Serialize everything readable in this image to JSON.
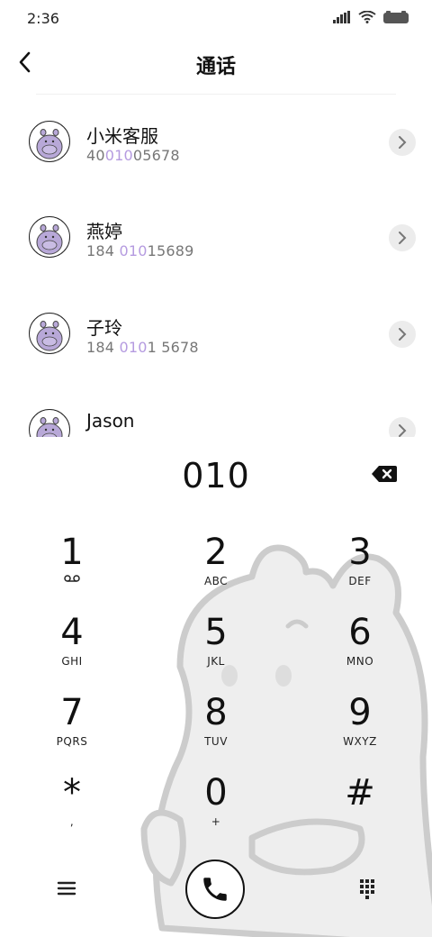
{
  "status_bar": {
    "time": "2:36"
  },
  "header": {
    "title": "通话"
  },
  "contacts": [
    {
      "name": "小米客服",
      "number_parts": [
        "40",
        "010",
        "05678"
      ]
    },
    {
      "name": "燕婷",
      "number_parts": [
        "184 ",
        "010",
        "15689"
      ]
    },
    {
      "name": "子玲",
      "number_parts": [
        "184 ",
        "010",
        "1 5678"
      ]
    },
    {
      "name": "Jason",
      "number_parts": [
        "",
        "",
        ""
      ]
    }
  ],
  "dialer": {
    "input": "010",
    "keys": [
      {
        "digit": "1",
        "letters": ""
      },
      {
        "digit": "2",
        "letters": "ABC"
      },
      {
        "digit": "3",
        "letters": "DEF"
      },
      {
        "digit": "4",
        "letters": "GHI"
      },
      {
        "digit": "5",
        "letters": "JKL"
      },
      {
        "digit": "6",
        "letters": "MNO"
      },
      {
        "digit": "7",
        "letters": "PQRS"
      },
      {
        "digit": "8",
        "letters": "TUV"
      },
      {
        "digit": "9",
        "letters": "WXYZ"
      },
      {
        "digit": "*",
        "letters": ","
      },
      {
        "digit": "0",
        "letters": "+"
      },
      {
        "digit": "#",
        "letters": ""
      }
    ]
  },
  "icons": {
    "back": "back-arrow-icon",
    "chevron": "chevron-right-icon",
    "backspace": "backspace-icon",
    "voicemail": "voicemail-icon",
    "menu": "menu-icon",
    "call": "phone-icon",
    "keypad": "keypad-icon"
  },
  "colors": {
    "highlight": "#b59be0",
    "avatar_fill": "#b8a8d8"
  }
}
